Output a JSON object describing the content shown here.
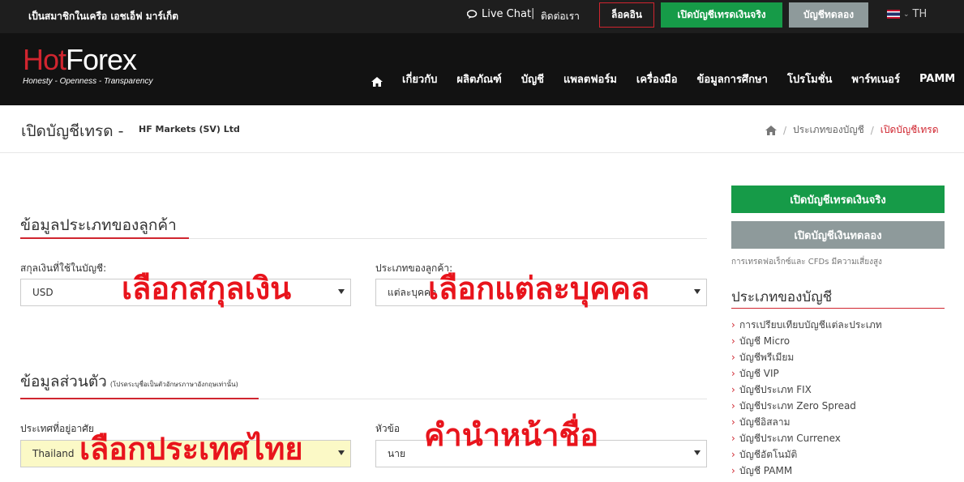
{
  "topbar": {
    "member_text": "เป็นสมาชิกในเครือ เอชเอ็ฟ มาร์เก็ต",
    "live_chat": "Live Chat",
    "separator": "|",
    "contact": "ติดต่อเรา",
    "login": "ล็อคอิน",
    "open_real": "เปิดบัญชีเทรดเงินจริง",
    "demo": "บัญชีทดลอง",
    "language": "TH"
  },
  "header": {
    "logo_hot": "Hot",
    "logo_forex": "Forex",
    "logo_tagline": "Honesty - Openness - Transparency",
    "nav": [
      "เกี่ยวกับ",
      "ผลิตภัณฑ์",
      "บัญชี",
      "แพลตฟอร์ม",
      "เครื่องมือ",
      "ข้อมูลการศึกษา",
      "โปรโมชั่น",
      "พาร์ทเนอร์",
      "PAMM"
    ]
  },
  "page": {
    "title": "เปิดบัญชีเทรด -",
    "subtitle": "HF Markets (SV) Ltd",
    "breadcrumb": [
      "ประเภทของบัญชี",
      "เปิดบัญชีเทรด"
    ]
  },
  "form": {
    "client_type_section": "ข้อมูลประเภทของลูกค้า",
    "currency_label": "สกุลเงินที่ใช้ในบัญชี:",
    "currency_value": "USD",
    "client_type_label": "ประเภทของลูกค้า:",
    "client_type_value": "แต่ละบุคคล",
    "personal_section": "ข้อมูลส่วนตัว",
    "personal_note": "(โปรดระบุชื่อเป็นตัวอักษรภาษาอังกฤษเท่านั้น)",
    "country_label": "ประเทศที่อยู่อาศัย",
    "country_value": "Thailand",
    "title_label": "หัวข้อ",
    "title_value": "นาย"
  },
  "annotations": {
    "currency": "เลือกสกุลเงิน",
    "individual": "เลือกแต่ละบุคคล",
    "country": "เลือกประเทศไทย",
    "name_title": "คำนำหน้าชื่อ"
  },
  "sidebar": {
    "open_real": "เปิดบัญชีเทรดเงินจริง",
    "open_demo": "เปิดบัญชีเงินทดลอง",
    "risk": "การเทรดฟอเร็กซ์และ CFDs มีความเสี่ยงสูง",
    "title": "ประเภทของบัญชี",
    "items": [
      "การเปรียบเทียบบัญชีแต่ละประเภท",
      "บัญชี Micro",
      "บัญชีพรีเมียม",
      "บัญชี VIP",
      "บัญชีประเภท FIX",
      "บัญชีประเภท Zero Spread",
      "บัญชีอิสลาม",
      "บัญชีประเภท Currenex",
      "บัญชีอัตโนมัติ",
      "บัญชี PAMM"
    ]
  },
  "colors": {
    "brand_red": "#d0252f",
    "green": "#169b48",
    "gray_button": "#8e9a9b",
    "annotation_red": "#e8141c"
  },
  "icons": [
    "chat-icon",
    "home-icon",
    "flag-icon",
    "chevron-down-icon",
    "chevron-right-icon"
  ]
}
